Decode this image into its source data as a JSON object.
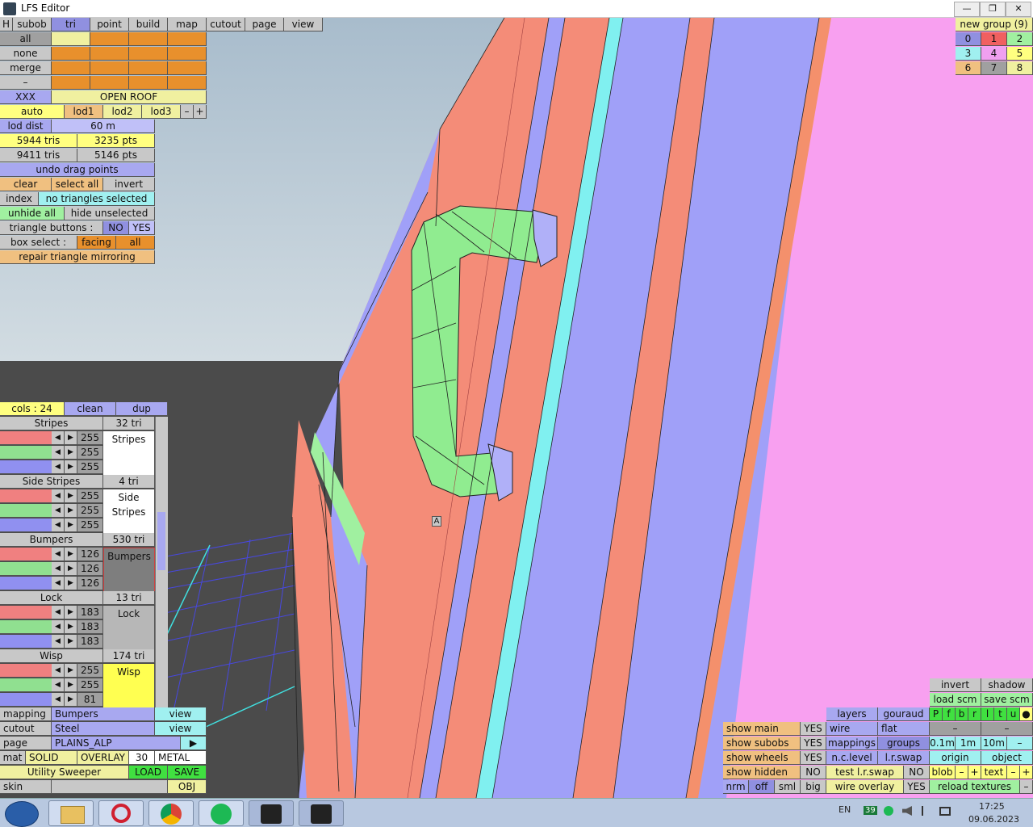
{
  "window": {
    "title": "LFS Editor",
    "min": "—",
    "max": "❐",
    "close": "✕"
  },
  "top_menu": {
    "h": "H",
    "tabs": [
      "subob",
      "tri",
      "point",
      "build",
      "map",
      "cutout",
      "page",
      "view"
    ]
  },
  "left": {
    "all": "all",
    "none": "none",
    "merge": "merge",
    "dash": "–",
    "xxx": "XXX",
    "open_roof": "OPEN ROOF",
    "auto": "auto",
    "lod1": "lod1",
    "lod2": "lod2",
    "lod3": "lod3",
    "minus": "–",
    "plus": "+",
    "lod_dist": "lod dist",
    "lod_dist_val": "60 m",
    "tris1": "5944 tris",
    "pts1": "3235 pts",
    "tris2": "9411 tris",
    "pts2": "5146 pts",
    "undo": "undo drag points",
    "clear": "clear",
    "select_all": "select all",
    "invert": "invert",
    "index": "index",
    "no_tri": "no triangles selected",
    "unhide": "unhide all",
    "hide_unsel": "hide unselected",
    "tri_buttons": "triangle buttons :",
    "no": "NO",
    "yes": "YES",
    "box_select": "box select :",
    "facing": "facing",
    "all2": "all",
    "repair": "repair triangle mirroring"
  },
  "cols": {
    "label": "cols : 24",
    "clean": "clean",
    "dup": "dup"
  },
  "materials": [
    {
      "name": "Stripes",
      "tri": "32 tri",
      "vals": [
        "255",
        "255",
        "255"
      ],
      "preview": "Stripes",
      "rgb": [
        "#f08080",
        "#90e090",
        "#9090f0",
        "#a0a0a0"
      ],
      "bg": "#ffffff"
    },
    {
      "name": "Side Stripes",
      "tri": "4 tri",
      "vals": [
        "255",
        "255",
        "255"
      ],
      "preview": "Side\nStripes",
      "rgb": [
        "#f08080",
        "#90e090",
        "#9090f0",
        "#a0a0a0"
      ],
      "bg": "#ffffff"
    },
    {
      "name": "Bumpers",
      "tri": "530 tri",
      "vals": [
        "126",
        "126",
        "126"
      ],
      "preview": "Bumpers",
      "rgb": [
        "#f08080",
        "#90e090",
        "#9090f0",
        "#a0a0a0"
      ],
      "bg": "#7e7e7e"
    },
    {
      "name": "Lock",
      "tri": "13 tri",
      "vals": [
        "183",
        "183",
        "183"
      ],
      "preview": "Lock",
      "rgb": [
        "#f08080",
        "#90e090",
        "#9090f0",
        "#a0a0a0"
      ],
      "bg": "#b7b7b7"
    },
    {
      "name": "Wisp",
      "tri": "174 tri",
      "vals": [
        "255",
        "255",
        "81"
      ],
      "preview": "Wisp",
      "rgb": [
        "#f08080",
        "#90e090",
        "#9090f0",
        "#a0a0a0"
      ],
      "bg": "#ffff51"
    }
  ],
  "bottom_left": {
    "mapping": "mapping",
    "mapping_val": "Bumpers",
    "view1": "view",
    "cutout": "cutout",
    "cutout_val": "Steel",
    "view2": "view",
    "page": "page",
    "page_val": "PLAINS_ALP",
    "page_arrow": "▶",
    "mat": "mat",
    "solid": "SOLID",
    "overlay": "OVERLAY",
    "num30": "30",
    "metal": "METAL",
    "utility": "Utility Sweeper",
    "load": "LOAD",
    "save": "SAVE",
    "skin": "skin",
    "obj": "OBJ"
  },
  "groups": {
    "title": "new group (9)",
    "cells": [
      "0",
      "1",
      "2",
      "3",
      "4",
      "5",
      "6",
      "7",
      "8"
    ]
  },
  "bottom_right": {
    "invert": "invert",
    "shadow": "shadow",
    "load_scm": "load scm",
    "save_scm": "save scm",
    "layers": "layers",
    "gouraud": "gouraud",
    "letters": [
      "P",
      "f",
      "b",
      "r",
      "l",
      "t",
      "u",
      "●"
    ],
    "show_main": "show main",
    "show_main_v": "YES",
    "wire": "wire",
    "flat": "flat",
    "show_subobs": "show subobs",
    "show_subobs_v": "YES",
    "mappings": "mappings",
    "groups": "groups",
    "d01": "0.1m",
    "d1": "1m",
    "d10": "10m",
    "dm": "–",
    "show_wheels": "show wheels",
    "show_wheels_v": "YES",
    "nc_level": "n.c.level",
    "lr_swap": "l.r.swap",
    "origin": "origin",
    "object": "object",
    "show_hidden": "show hidden",
    "show_hidden_v": "NO",
    "test_lr": "test l.r.swap",
    "test_lr_v": "NO",
    "blob": "blob",
    "bm": "–",
    "bp": "+",
    "text": "text",
    "tm": "–",
    "tp": "+",
    "nrm": "nrm",
    "off": "off",
    "sml": "sml",
    "big": "big",
    "wire_overlay": "wire overlay",
    "wo_v": "YES",
    "reload": "reload textures",
    "rdash": "–",
    "dash1": "–",
    "dash2": "–",
    "dash3": "–"
  },
  "viewport": {
    "marker": "A"
  },
  "taskbar": {
    "lang": "EN",
    "badge": "39",
    "time": "17:25",
    "date": "09.06.2023"
  }
}
